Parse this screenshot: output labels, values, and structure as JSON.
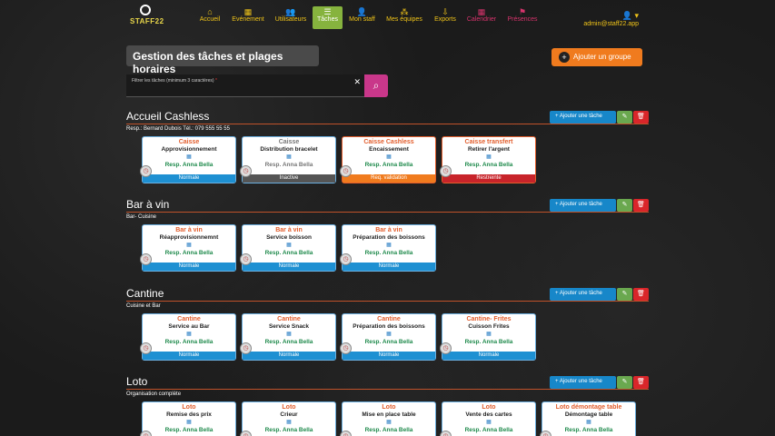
{
  "logo": {
    "text": "STAFF22"
  },
  "nav": [
    {
      "label": "Accueil",
      "icon": "home-icon",
      "glyph": "⌂"
    },
    {
      "label": "Evénement",
      "icon": "calendar-icon",
      "glyph": "▦"
    },
    {
      "label": "Utilisateurs",
      "icon": "users-icon",
      "glyph": "👥"
    },
    {
      "label": "Tâches",
      "icon": "tasks-icon",
      "glyph": "☰"
    },
    {
      "label": "Mon staff",
      "icon": "user-icon",
      "glyph": "👤"
    },
    {
      "label": "Mes équipes",
      "icon": "teams-icon",
      "glyph": "⁂"
    },
    {
      "label": "Exports",
      "icon": "export-icon",
      "glyph": "⇩"
    },
    {
      "label": "Calendrier",
      "icon": "calendar-icon",
      "glyph": "▦"
    },
    {
      "label": "Présences",
      "icon": "flag-icon",
      "glyph": "⚑"
    }
  ],
  "user": {
    "email": "admin@staff22.app",
    "icon": "user-icon",
    "glyph": "👤 ▾"
  },
  "page": {
    "title": "Gestion des tâches et plages horaires",
    "add_group": "Ajouter un groupe",
    "filter_label": "Filtrer les tâches (minimum 3 caractères)",
    "filter_required": "*"
  },
  "buttons": {
    "add_task": "Ajouter une tâche"
  },
  "groups": [
    {
      "title": "Accueil Cashless",
      "desc": "Resp.: Bernard Dubois Tél.: 079 555 55 55",
      "tasks": [
        {
          "cat": "Caisse",
          "name": "Approvisionnement",
          "resp": "Resp. Anna Bella",
          "status": "Normale"
        },
        {
          "cat": "Caisse",
          "name": "Distribution bracelet",
          "resp": "Resp. Anna Bella",
          "status": "Inactive"
        },
        {
          "cat": "Caisse Cashless",
          "name": "Encaissement",
          "resp": "Resp. Anna Bella",
          "status": "Req. validation"
        },
        {
          "cat": "Caisse transfert",
          "name": "Retirer l'argent",
          "resp": "Resp. Anna Bella",
          "status": "Restreinte"
        }
      ]
    },
    {
      "title": "Bar à vin",
      "desc": "Bar- Cuisine",
      "tasks": [
        {
          "cat": "Bar à vin",
          "name": "Réapprovisionnemnt",
          "resp": "Resp. Anna Bella",
          "status": "Normale"
        },
        {
          "cat": "Bar à vin",
          "name": "Service boisson",
          "resp": "Resp. Anna Bella",
          "status": "Normale"
        },
        {
          "cat": "Bar à vin",
          "name": "Préparation des boissons",
          "resp": "Resp. Anna Bella",
          "status": "Normale"
        }
      ]
    },
    {
      "title": "Cantine",
      "desc": "Cuisine et Bar",
      "tasks": [
        {
          "cat": "Cantine",
          "name": "Service au Bar",
          "resp": "Resp. Anna Bella",
          "status": "Normale"
        },
        {
          "cat": "Cantine",
          "name": "Service Snack",
          "resp": "Resp. Anna Bella",
          "status": "Normale"
        },
        {
          "cat": "Cantine",
          "name": "Préparation des boissons",
          "resp": "Resp. Anna Bella",
          "status": "Normale"
        },
        {
          "cat": "Cantine- Frites",
          "name": "Cuisson Frites",
          "resp": "Resp. Anna Bella",
          "status": "Normale"
        }
      ]
    },
    {
      "title": "Loto",
      "desc": "Organisation complète",
      "tasks": [
        {
          "cat": "Loto",
          "name": "Remise des prix",
          "resp": "Resp. Anna Bella",
          "status": "Normale"
        },
        {
          "cat": "Loto",
          "name": "Crieur",
          "resp": "Resp. Anna Bella",
          "status": "Normale"
        },
        {
          "cat": "Loto",
          "name": "Mise en place table",
          "resp": "Resp. Anna Bella",
          "status": "Normale"
        },
        {
          "cat": "Loto",
          "name": "Vente des cartes",
          "resp": "Resp. Anna Bella",
          "status": "Normale"
        },
        {
          "cat": "Loto démontage table",
          "name": "Démontage table",
          "resp": "Resp. Anna Bella",
          "status": "Normale"
        }
      ]
    }
  ]
}
